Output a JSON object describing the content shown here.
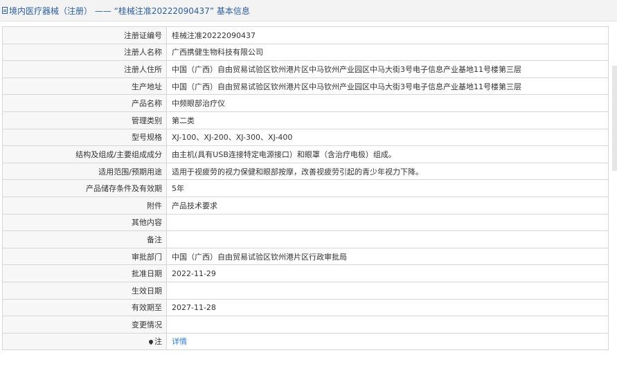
{
  "header": {
    "title": "境内医疗器械（注册） —— “桂械注准20222090437” 基本信息"
  },
  "rows": [
    {
      "label": "注册证编号",
      "value": "桂械注准20222090437"
    },
    {
      "label": "注册人名称",
      "value": "广西携健生物科技有限公司"
    },
    {
      "label": "注册人住所",
      "value": "中国（广西）自由贸易试验区钦州港片区中马钦州产业园区中马大街3号电子信息产业基地11号楼第三层"
    },
    {
      "label": "生产地址",
      "value": "中国（广西）自由贸易试验区钦州港片区中马钦州产业园区中马大街3号电子信息产业基地11号楼第三层"
    },
    {
      "label": "产品名称",
      "value": "中频眼部治疗仪"
    },
    {
      "label": "管理类别",
      "value": "第二类"
    },
    {
      "label": "型号规格",
      "value": "XJ-100、XJ-200、XJ-300、XJ-400"
    },
    {
      "label": "结构及组成/主要组成成分",
      "value": "由主机(具有USB连接特定电源接口）和眼罩（含治疗电极）组成。"
    },
    {
      "label": "适用范围/预期用途",
      "value": "适用于视疲劳的视力保健和眼部按摩，改善视疲劳引起的青少年视力下降。"
    },
    {
      "label": "产品储存条件及有效期",
      "value": "5年"
    },
    {
      "label": "附件",
      "value": "产品技术要求"
    },
    {
      "label": "其他内容",
      "value": ""
    },
    {
      "label": "备注",
      "value": ""
    },
    {
      "label": "审批部门",
      "value": "中国（广西）自由贸易试验区钦州港片区行政审批局"
    },
    {
      "label": "批准日期",
      "value": "2022-11-29"
    },
    {
      "label": "生效日期",
      "value": ""
    },
    {
      "label": "有效期至",
      "value": "2027-11-28"
    },
    {
      "label": "变更情况",
      "value": ""
    }
  ],
  "note_row": {
    "label": "注",
    "icon": "pin-icon",
    "link_text": "详情"
  }
}
